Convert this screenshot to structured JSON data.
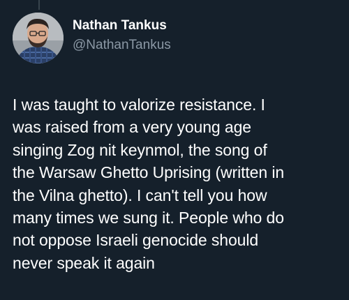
{
  "tweet": {
    "author": {
      "display_name": "Nathan Tankus",
      "handle": "@NathanTankus",
      "avatar_icon": "profile-photo"
    },
    "text": "I was taught to valorize resistance. I\nwas raised from a very young age\nsinging Zog nit keynmol, the song of\nthe Warsaw Ghetto Uprising (written in\nthe Vilna ghetto). I can't tell you how\nmany times we sung it. People who do\nnot oppose Israeli genocide should\nnever speak it again"
  },
  "colors": {
    "background": "#15202b",
    "primary_text": "#ffffff",
    "secondary_text": "#8b98a5",
    "thread_line": "#38444d"
  }
}
